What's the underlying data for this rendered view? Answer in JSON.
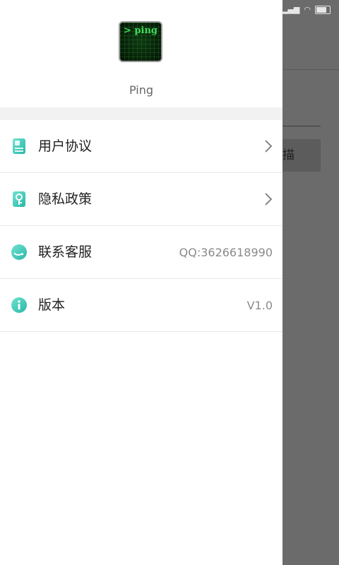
{
  "app": {
    "name": "Ping",
    "logo_text": "> ping"
  },
  "background": {
    "scan_button_label": "描"
  },
  "menu": {
    "items": [
      {
        "id": "user-agreement",
        "label": "用户协议",
        "icon": "document-icon",
        "value": "",
        "chevron": true
      },
      {
        "id": "privacy-policy",
        "label": "隐私政策",
        "icon": "key-icon",
        "value": "",
        "chevron": true
      },
      {
        "id": "contact-support",
        "label": "联系客服",
        "icon": "headset-icon",
        "value": "QQ:3626618990",
        "chevron": false
      },
      {
        "id": "version",
        "label": "版本",
        "icon": "info-icon",
        "value": "V1.0",
        "chevron": false
      }
    ]
  },
  "colors": {
    "accent": "#3cc7b4",
    "overlay": "#6b6b6b",
    "label": "#222222",
    "value": "#8a8a8a"
  }
}
